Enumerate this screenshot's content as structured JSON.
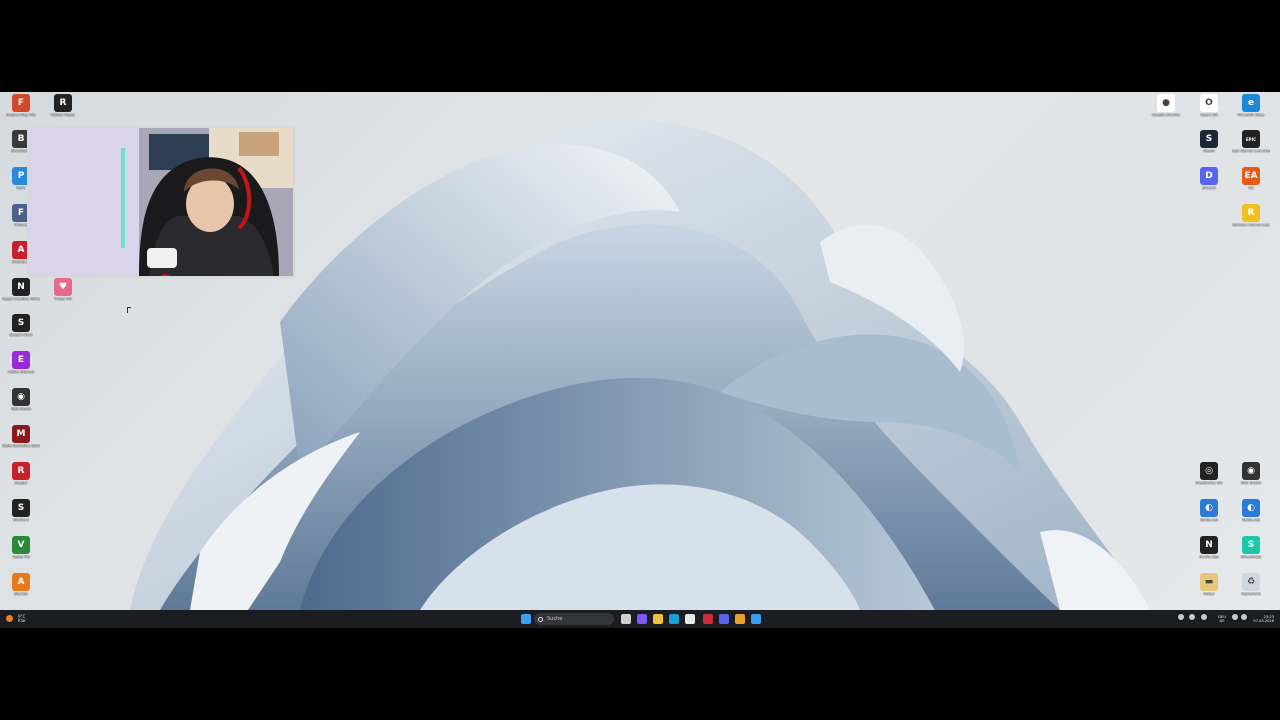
{
  "desktop_icons_left": [
    {
      "id": "l1",
      "label": "Garena Free Fire",
      "color": "#d04a2a",
      "glyph": "F"
    },
    {
      "id": "l2",
      "label": "Roblox Player",
      "color": "#222222",
      "glyph": "R"
    },
    {
      "id": "l3",
      "label": "Bluestacks",
      "color": "#3a3a3a",
      "glyph": "B"
    },
    {
      "id": "l4",
      "label": "Paint",
      "color": "#2a8ad8",
      "glyph": "P"
    },
    {
      "id": "l5",
      "label": "Filmora",
      "color": "#4a5f8a",
      "glyph": "F"
    },
    {
      "id": "l6",
      "label": "Among Us",
      "color": "#c8202a",
      "glyph": "A"
    },
    {
      "id": "l7",
      "label": "Vegas Creative Software",
      "color": "#222222",
      "glyph": "N"
    },
    {
      "id": "l8",
      "label": "Tinder Pin",
      "color": "#e86a8a",
      "glyph": "♥"
    },
    {
      "id": "l9",
      "label": "Stream Deck",
      "color": "#222222",
      "glyph": "S"
    },
    {
      "id": "l10",
      "label": "Adobe Express",
      "color": "#9a2ad8",
      "glyph": "E"
    },
    {
      "id": "l11",
      "label": "OBS Studio",
      "color": "#333333",
      "glyph": "◉"
    },
    {
      "id": "l12",
      "label": "Mafia Definitive Edition",
      "color": "#8a1a1a",
      "glyph": "M"
    },
    {
      "id": "l13",
      "label": "Reaper",
      "color": "#c8202a",
      "glyph": "R"
    },
    {
      "id": "l14",
      "label": "Shortcut",
      "color": "#222222",
      "glyph": "S"
    },
    {
      "id": "l15",
      "label": "Vegas Pro",
      "color": "#2a8a3a",
      "glyph": "V"
    },
    {
      "id": "l16",
      "label": "Blender",
      "color": "#e87a1a",
      "glyph": "A"
    }
  ],
  "desktop_icons_right": [
    {
      "id": "r1",
      "label": "Google Chrome",
      "color": "#ffffff",
      "glyph": "●"
    },
    {
      "id": "r2",
      "label": "Opera GX",
      "color": "#ffffff",
      "glyph": "O"
    },
    {
      "id": "r3",
      "label": "Microsoft Edge",
      "color": "#1a8ad8",
      "glyph": "e"
    },
    {
      "id": "r4",
      "label": "Steam",
      "color": "#1b2838",
      "glyph": "S"
    },
    {
      "id": "r5",
      "label": "Epic Games Launcher",
      "color": "#222222",
      "glyph": "EPIC"
    },
    {
      "id": "r6",
      "label": "Discord",
      "color": "#5865f2",
      "glyph": "D"
    },
    {
      "id": "r7",
      "label": "EA",
      "color": "#e85a1a",
      "glyph": "EA"
    },
    {
      "id": "r8",
      "label": "Rockstar Games Launcher",
      "color": "#f0c020",
      "glyph": "R"
    },
    {
      "id": "r9",
      "label": "SteelSeries GG",
      "color": "#222222",
      "glyph": "◎"
    },
    {
      "id": "r10",
      "label": "OBS Studio",
      "color": "#333333",
      "glyph": "◉"
    },
    {
      "id": "r11",
      "label": "Battle.net",
      "color": "#2a7ad8",
      "glyph": "◐"
    },
    {
      "id": "r12",
      "label": "Battle.net",
      "color": "#2a7ad8",
      "glyph": "◐"
    },
    {
      "id": "r13",
      "label": "Nvidia App",
      "color": "#222222",
      "glyph": "N"
    },
    {
      "id": "r14",
      "label": "Streamlabs",
      "color": "#1ac8a8",
      "glyph": "S"
    },
    {
      "id": "r15",
      "label": "Folder",
      "color": "#e8c878",
      "glyph": "▬"
    },
    {
      "id": "r16",
      "label": "Papierkorb",
      "color": "#cfd8e0",
      "glyph": "♻"
    }
  ],
  "taskbar": {
    "weather_text": "9°C",
    "weather_sub": "Klar",
    "search_placeholder": "Suche",
    "pinned": [
      {
        "id": "t1",
        "name": "windows-start",
        "color": "#3aa0f0"
      },
      {
        "id": "t2",
        "name": "task-view",
        "color": "#cfcfcf"
      },
      {
        "id": "t3",
        "name": "copilot",
        "color": "#7a5af0"
      },
      {
        "id": "t4",
        "name": "file-explorer",
        "color": "#f0c040"
      },
      {
        "id": "t5",
        "name": "edge",
        "color": "#1aa0d8"
      },
      {
        "id": "t6",
        "name": "microsoft-store",
        "color": "#e8e8e8"
      },
      {
        "id": "t7",
        "name": "opera-gx",
        "color": "#d02a3a"
      },
      {
        "id": "t8",
        "name": "discord",
        "color": "#5865f2"
      },
      {
        "id": "t9",
        "name": "chrome",
        "color": "#e8a030"
      },
      {
        "id": "t10",
        "name": "battle-net",
        "color": "#3a9af0"
      }
    ],
    "lang_top": "DEU",
    "lang_bottom": "DE",
    "time": "23:23",
    "date": "07.03.2026"
  }
}
